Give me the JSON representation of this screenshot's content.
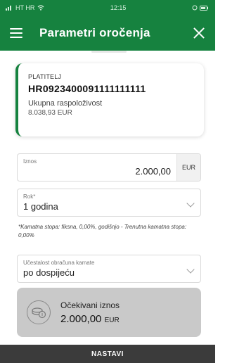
{
  "status_bar": {
    "carrier": "HT HR",
    "time": "12:15"
  },
  "header": {
    "title": "Parametri oročenja",
    "menu_icon": "hamburger-menu-icon",
    "close_icon": "close-icon"
  },
  "payer": {
    "label": "PLATITELJ",
    "iban": "HR0923400091111111111",
    "available_label": "Ukupna raspoloživost",
    "available_value": "8.038,93 EUR"
  },
  "amount": {
    "label": "Iznos",
    "value": "2.000,00",
    "currency": "EUR"
  },
  "term": {
    "label": "Rok*",
    "value": "1 godina"
  },
  "note": "*Kamatna stopa: fiksna, 0,00%, godišnjo - Trenutna kamatna stopa: 0,00%",
  "interest_frequency": {
    "label": "Učestalost obračuna kamate",
    "value": "po dospijeću"
  },
  "expected": {
    "label": "Očekivani iznos",
    "value": "2.000,00",
    "currency": "EUR",
    "icon": "coins-icon"
  },
  "continue_button": "NASTAVI",
  "colors": {
    "brand_green": "#16823f",
    "expected_bg": "#c9c9c9",
    "button_bg": "#3b3b3b"
  }
}
